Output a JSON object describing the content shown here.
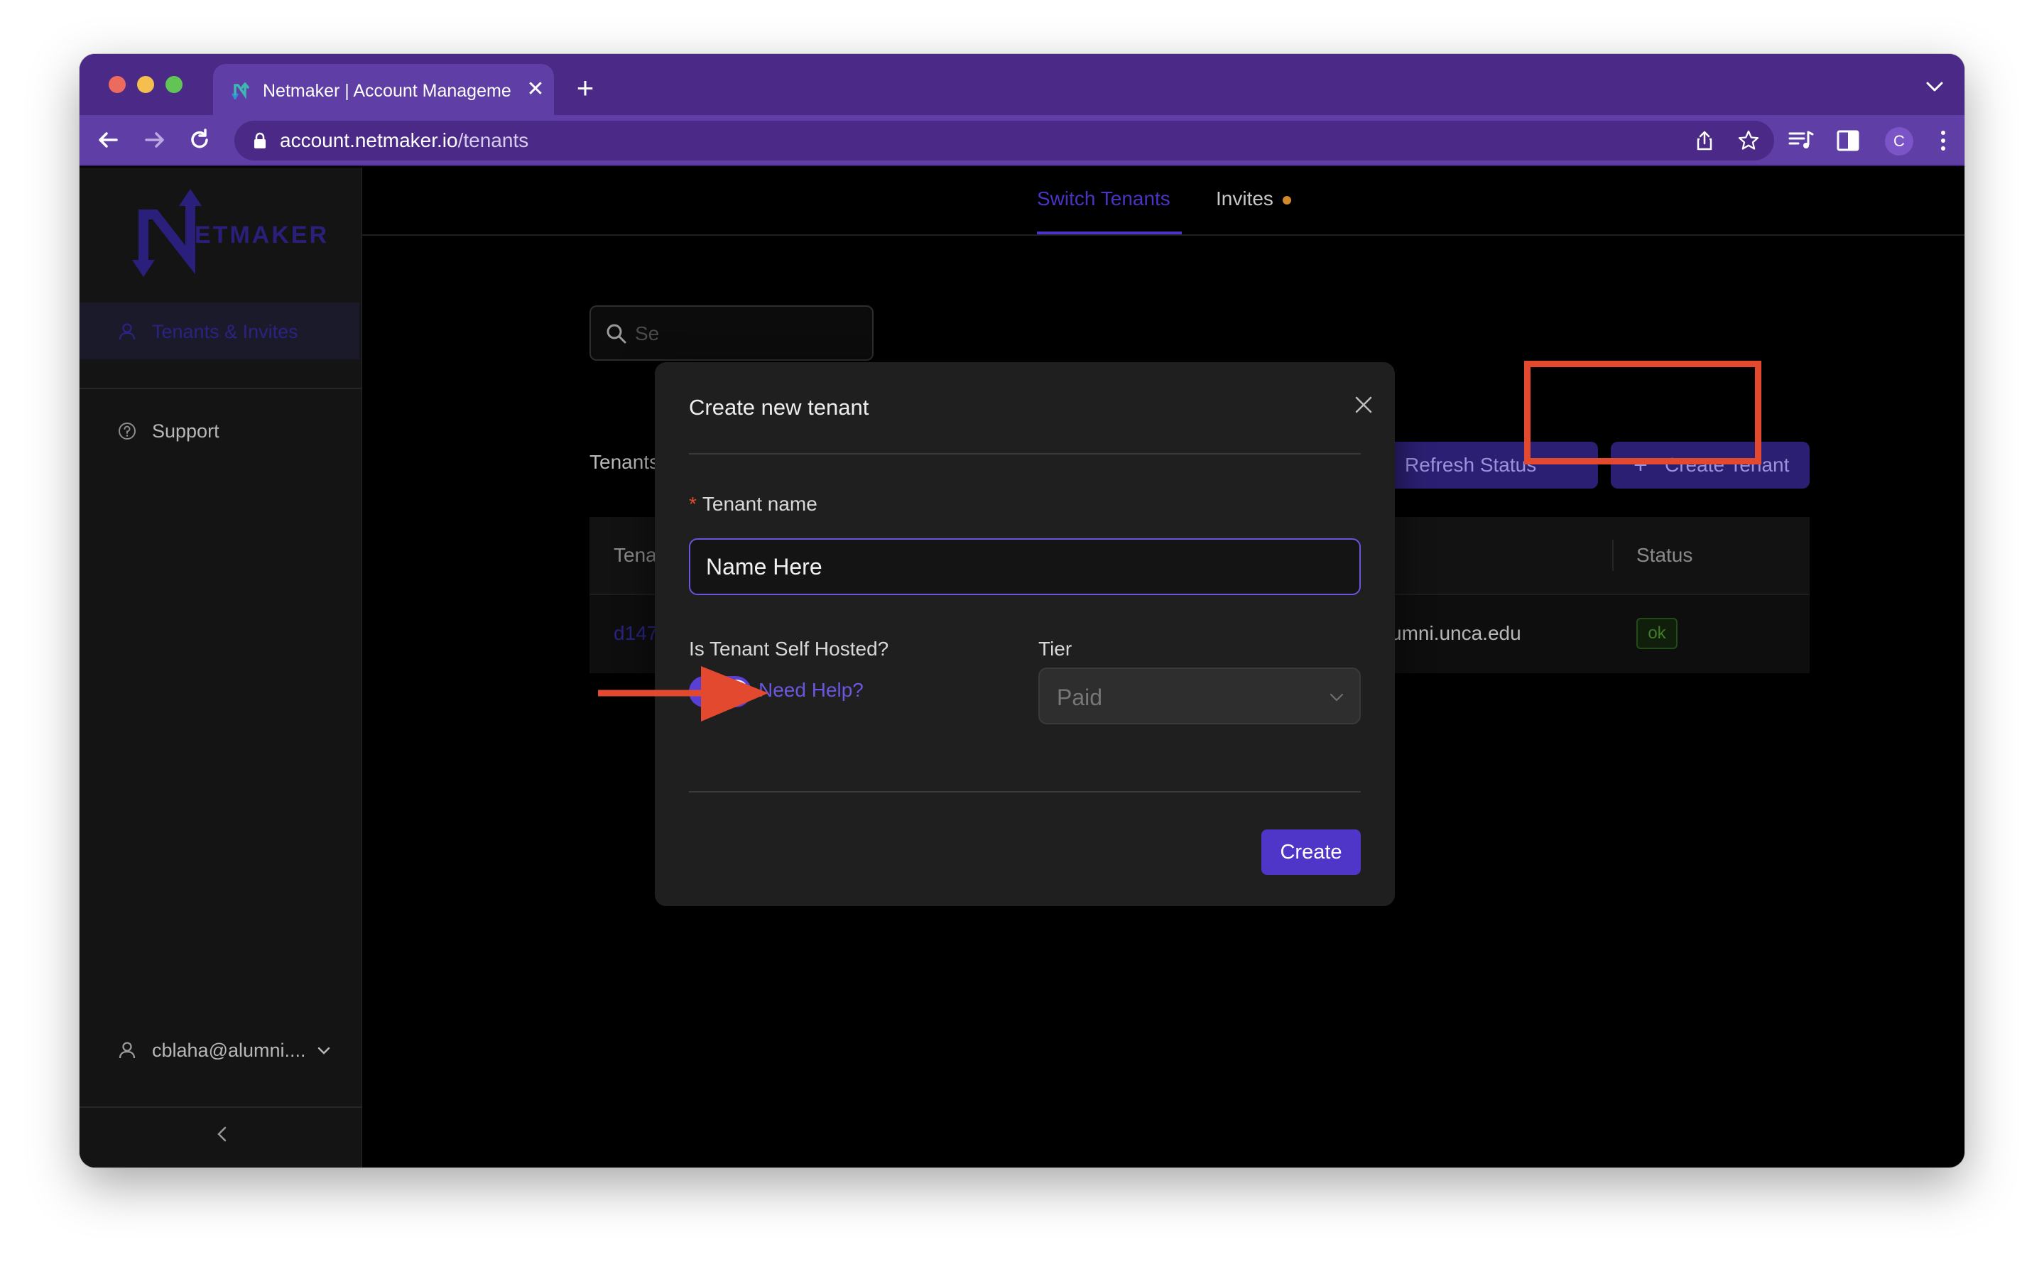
{
  "browser": {
    "tab_title": "Netmaker | Account Management",
    "tab_close": "✕",
    "new_tab": "+",
    "url_host": "account.netmaker.io",
    "url_path": "/tenants",
    "profile_initial": "C"
  },
  "sidebar": {
    "logo_text": "ETMAKER",
    "logo_letter": "N",
    "items": [
      {
        "label": "Tenants & Invites",
        "icon": "user-icon",
        "active": true
      },
      {
        "label": "Support",
        "icon": "help-circle-icon",
        "active": false
      }
    ],
    "account_label": "cblaha@alumni...."
  },
  "topnav": {
    "tabs": [
      {
        "label": "Switch Tenants",
        "active": true
      },
      {
        "label": "Invites",
        "active": false,
        "has_dot": true
      }
    ]
  },
  "page": {
    "search_placeholder": "Se",
    "section_label": "Tenants",
    "refresh_button": "Refresh Status",
    "create_tenant_button": "Create Tenant",
    "table": {
      "headers": [
        "Tena",
        "Status"
      ],
      "rows": [
        {
          "id": "d147",
          "owner": "umni.unca.edu",
          "status": "ok"
        }
      ]
    }
  },
  "modal": {
    "title": "Create new tenant",
    "name_label": "Tenant name",
    "name_required_mark": "*",
    "name_value": "Name Here",
    "self_hosted_label": "Is Tenant Self Hosted?",
    "self_hosted_enabled": true,
    "help_link": "Need Help?",
    "tier_label": "Tier",
    "tier_value": "Paid",
    "create_button": "Create"
  },
  "colors": {
    "browser_chrome": "#4a2a86",
    "accent": "#4f36c8",
    "annotation": "#e2492e"
  }
}
